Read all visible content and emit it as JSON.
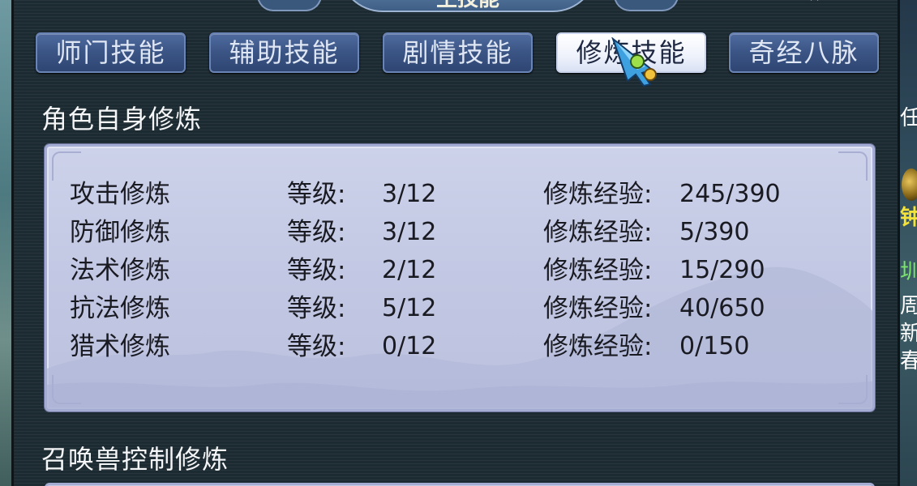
{
  "window": {
    "title": "生技能"
  },
  "tabs": [
    {
      "label": "师门技能",
      "active": false
    },
    {
      "label": "辅助技能",
      "active": false
    },
    {
      "label": "剧情技能",
      "active": false
    },
    {
      "label": "修炼技能",
      "active": true
    },
    {
      "label": "奇经八脉",
      "active": false
    }
  ],
  "self_cultivation": {
    "title": "角色自身修炼",
    "level_label": "等级:",
    "exp_label": "修炼经验:",
    "rows": [
      {
        "name": "攻击修炼",
        "level": "3/12",
        "exp": "245/390"
      },
      {
        "name": "防御修炼",
        "level": "3/12",
        "exp": "5/390"
      },
      {
        "name": "法术修炼",
        "level": "2/12",
        "exp": "15/290"
      },
      {
        "name": "抗法修炼",
        "level": "5/12",
        "exp": "40/650"
      },
      {
        "name": "猎术修炼",
        "level": "0/12",
        "exp": "0/150"
      }
    ]
  },
  "pet_cultivation": {
    "title": "召唤兽控制修炼"
  },
  "right_edge_fragments": [
    {
      "text": "任",
      "color": "#ffffff"
    },
    {
      "text": "钟",
      "color": "#f2e23a"
    },
    {
      "text": "圳",
      "color": "#7be36a"
    },
    {
      "text": "周",
      "color": "#ffffff"
    },
    {
      "text": "新",
      "color": "#ffffff"
    },
    {
      "text": "春",
      "color": "#ffffff"
    }
  ],
  "colors": {
    "tab_bg": "#3a5484",
    "tab_active_bg": "#eef2fb",
    "panel_bg": "#c4c9e4",
    "window_bg": "#1c2a31"
  }
}
